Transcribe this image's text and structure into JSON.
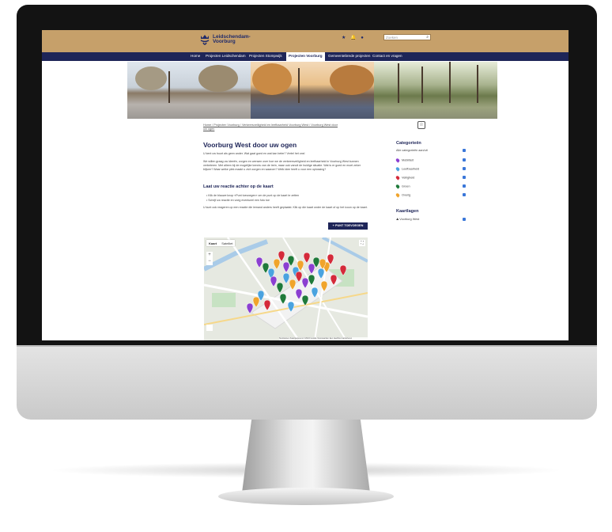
{
  "header": {
    "logo_line1": "Leidschendam-",
    "logo_line2": "Voorburg",
    "icons": [
      "star-icon",
      "bell-icon",
      "user-icon"
    ],
    "search_placeholder": "Zoeken",
    "search_icon": "search-icon"
  },
  "nav": [
    {
      "label": "Home",
      "active": false
    },
    {
      "label": "Projecten Leidschendam",
      "active": false
    },
    {
      "label": "Projecten Stompwijk",
      "active": false
    },
    {
      "label": "Projecten Voorburg",
      "active": true
    },
    {
      "label": "Gemeentebrede projecten",
      "active": false
    },
    {
      "label": "Contact en vragen",
      "active": false
    }
  ],
  "breadcrumb": {
    "text": "Home / Projecten Voorburg / Verkeersveiligheid en leefbaarheid Voorburg West / Voorburg West door uw ogen"
  },
  "page": {
    "title": "Voorburg West door uw ogen",
    "intro": "U kent uw buurt als geen ander. Wat gaat goed en wat kan beter? Vertel het ons!",
    "para": "We willen graag uw ideeën, zorgen en wensen over hoe we de verkeersveiligheid en leefbaarheid in Voorburg West kunnen verbeteren. Met alleen bij de mogelijke kennis van de trein, maar ook vanuit de huidige situatie. Wat is er goed en moet zeker blijven? Waar welke plek maakt u zich zorgen en waarom? Welk idee heeft u voor een oplossing?",
    "subtitle": "Laat uw reactie achter op de kaart",
    "bullets": [
      "Klik de blauwe knop «Punt toevoegen» om de punt op de kaart te zetten",
      "Schrijf uw reactie en voeg eventueel een foto toe"
    ],
    "outro": "U kunt ook reageren op een reactie die iemand anders heeft geplaatst. Klik op die kaart onder de kaart of op het icoon op de kaart.",
    "add_button": "+ PUNT TOEVOEGEN"
  },
  "map": {
    "tabs": [
      "Kaart",
      "Satelliet"
    ],
    "footer": "Sneltoetsen   Kaartgegevens ©2024 Google   Voorwaarden   Een kaartfout rapporteren",
    "zoom_in": "+",
    "zoom_out": "−"
  },
  "sidebar": {
    "categories_title": "Categorieën",
    "all_label": "Alle categorieën aan/uit",
    "categories": [
      {
        "label": "Mobiliteit",
        "color": "#8b3fd1"
      },
      {
        "label": "Leefbaarheid",
        "color": "#4aa3df"
      },
      {
        "label": "Veiligheid",
        "color": "#d42a3a"
      },
      {
        "label": "Groen",
        "color": "#1f7a3a"
      },
      {
        "label": "Overig",
        "color": "#f0a42c"
      }
    ],
    "layers_title": "Kaartlagen",
    "layers": [
      {
        "label": "Voorburg West"
      }
    ]
  }
}
